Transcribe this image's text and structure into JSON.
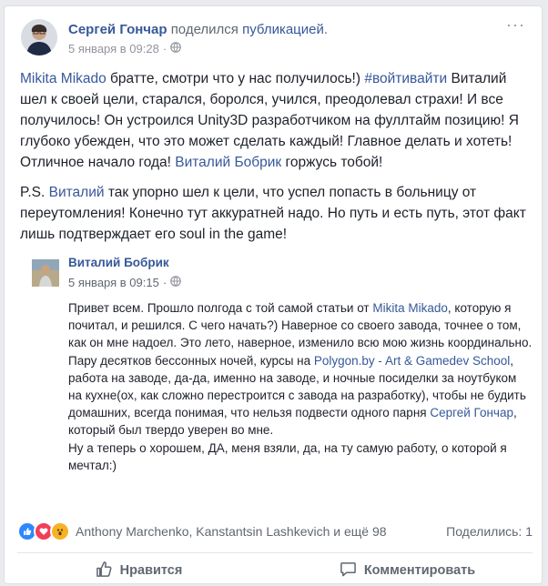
{
  "post": {
    "author": "Сергей Гончар",
    "action_text": "поделился",
    "action_link": "публикацией",
    "action_end": ".",
    "timestamp": "5 января в 09:28",
    "more": "···",
    "p1": [
      {
        "text": "Mikita Mikado",
        "link": true
      },
      {
        "text": " братте, смотри что у нас получилось!) ",
        "link": false
      },
      {
        "text": "#войтивайти",
        "link": true
      },
      {
        "text": " Виталий шел к своей цели, старался, боролся, учился, преодолевал страхи! И все получилось! Он устроился Unity3D разработчиком на фуллтайм позицию! Я глубоко убежден, что это может сделать каждый! Главное делать и хотеть! Отличное начало года! ",
        "link": false
      },
      {
        "text": "Виталий Бобрик",
        "link": true
      },
      {
        "text": " горжусь тобой!",
        "link": false
      }
    ],
    "p2": [
      {
        "text": "P.S. ",
        "link": false
      },
      {
        "text": "Виталий",
        "link": true
      },
      {
        "text": " так упорно шел к цели, что успел попасть в больницу от переутомления! Конечно тут аккуратней надо. Но путь и есть путь, этот факт лишь подтверждает его soul in the game!",
        "link": false
      }
    ]
  },
  "shared": {
    "author": "Виталий Бобрик",
    "timestamp": "5 января в 09:15",
    "p1": [
      {
        "text": "Привет всем. Прошло полгода с той самой статьи от ",
        "link": false
      },
      {
        "text": "Mikita Mikado",
        "link": true
      },
      {
        "text": ", которую я почитал, и решился. С чего начать?) Наверное со своего завода, точнее о том, как он мне надоел. Это лето, наверное, изменило всю мою жизнь координально. Пару десятков бессонных ночей, курсы на ",
        "link": false
      },
      {
        "text": "Polygon.by - Art & Gamedev School",
        "link": true
      },
      {
        "text": ", работа на заводе, да-да, именно на заводе, и ночные посиделки за ноутбуком на кухне(ох, как сложно перестроится с завода на разработку), чтобы не будить домашних, всегда понимая, что нельзя подвести одного парня ",
        "link": false
      },
      {
        "text": "Сергей Гончар",
        "link": true
      },
      {
        "text": ", который был твердо уверен во мне.",
        "link": false
      }
    ],
    "p2": "Ну а теперь о хорошем, ДА, меня взяли, да, на ту самую работу, о которой я мечтал:)"
  },
  "footer": {
    "reactions_text": "Anthony Marchenko, Kanstantsin Lashkevich и ещё 98",
    "shares_text": "Поделились: 1",
    "like_label": "Нравится",
    "comment_label": "Комментировать"
  },
  "icons": {
    "globe": "globe-icon",
    "like": "like-icon",
    "love": "love-icon",
    "wow": "wow-icon",
    "comment": "comment-icon"
  },
  "colors": {
    "link": "#365899",
    "muted": "#90949c",
    "like": "#2d88ff",
    "love": "#f33e58",
    "wow": "#f7b125"
  }
}
